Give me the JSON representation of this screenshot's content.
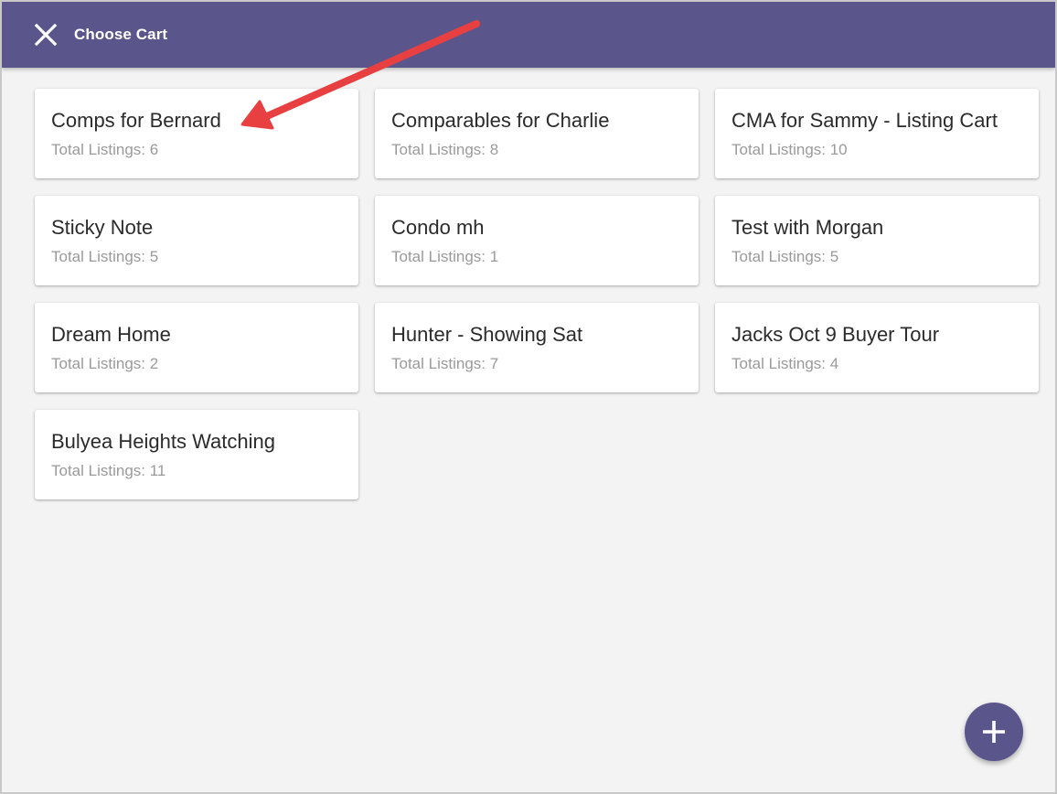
{
  "header": {
    "title": "Choose Cart",
    "close_icon": "close-icon",
    "background_color": "#5a568c"
  },
  "carts": [
    {
      "name": "Comps for Bernard",
      "count_label": "Total Listings: 6"
    },
    {
      "name": "Comparables for Charlie",
      "count_label": "Total Listings: 8"
    },
    {
      "name": "CMA for Sammy - Listing Cart",
      "count_label": "Total Listings: 10"
    },
    {
      "name": "Sticky Note",
      "count_label": "Total Listings: 5"
    },
    {
      "name": "Condo mh",
      "count_label": "Total Listings: 1"
    },
    {
      "name": "Test with Morgan",
      "count_label": "Total Listings: 5"
    },
    {
      "name": "Dream Home",
      "count_label": "Total Listings: 2"
    },
    {
      "name": "Hunter - Showing Sat",
      "count_label": "Total Listings: 7"
    },
    {
      "name": "Jacks Oct 9 Buyer Tour",
      "count_label": "Total Listings: 4"
    },
    {
      "name": "Bulyea Heights Watching",
      "count_label": "Total Listings: 11"
    }
  ],
  "fab": {
    "icon": "plus-icon",
    "color": "#5a568c"
  },
  "annotation": {
    "icon": "annotation-arrow-icon",
    "color": "#e84040"
  }
}
